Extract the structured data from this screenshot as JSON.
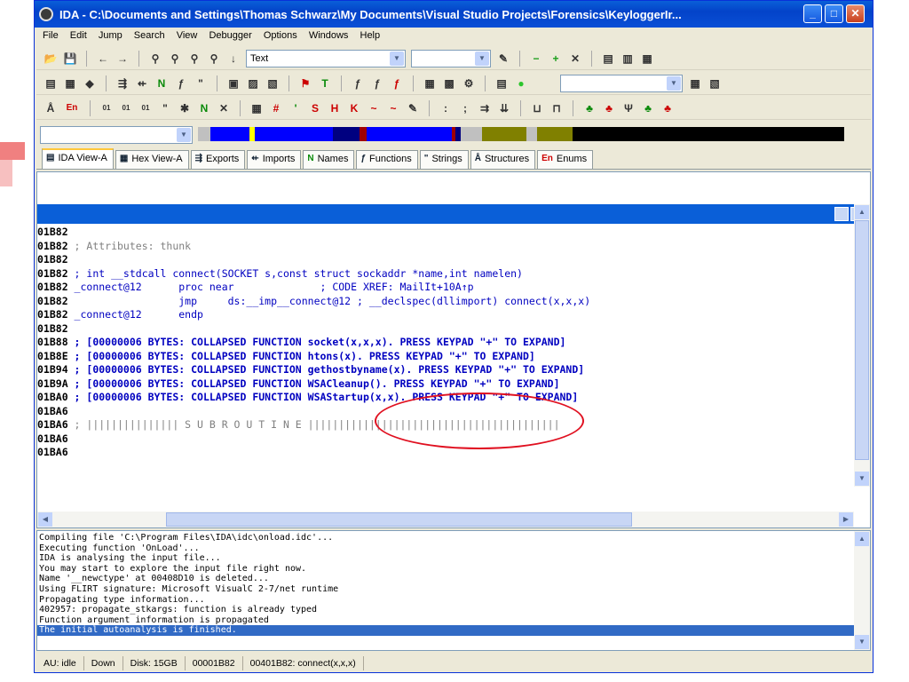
{
  "window": {
    "title": "IDA - C:\\Documents and Settings\\Thomas Schwarz\\My Documents\\Visual Studio Projects\\Forensics\\KeyloggerIr..."
  },
  "menu": [
    "File",
    "Edit",
    "Jump",
    "Search",
    "View",
    "Debugger",
    "Options",
    "Windows",
    "Help"
  ],
  "toolbar": {
    "text_combo_value": "Text"
  },
  "tabs": [
    {
      "label": "IDA View-A",
      "icon": "view-icon"
    },
    {
      "label": "Hex View-A",
      "icon": "hex-icon"
    },
    {
      "label": "Exports",
      "icon": "exports-icon"
    },
    {
      "label": "Imports",
      "icon": "imports-icon"
    },
    {
      "label": "Names",
      "icon": "names-icon"
    },
    {
      "label": "Functions",
      "icon": "functions-icon"
    },
    {
      "label": "Strings",
      "icon": "strings-icon"
    },
    {
      "label": "Structures",
      "icon": "structures-icon"
    },
    {
      "label": "Enums",
      "icon": "enums-icon"
    }
  ],
  "disasm": {
    "lines": [
      {
        "addr": "01B82",
        "text": ""
      },
      {
        "addr": "01B82",
        "text": " ; Attributes: thunk"
      },
      {
        "addr": "01B82",
        "text": ""
      },
      {
        "addr": "01B82",
        "text": " ; int __stdcall connect(SOCKET s,const struct sockaddr *name,int namelen)"
      },
      {
        "addr": "01B82",
        "text": " _connect@12      proc near              ; CODE XREF: MailIt+10A↑p"
      },
      {
        "addr": "01B82",
        "text": "                  jmp     ds:__imp__connect@12 ; __declspec(dllimport) connect(x,x,x)"
      },
      {
        "addr": "01B82",
        "text": " _connect@12      endp"
      },
      {
        "addr": "01B82",
        "text": ""
      },
      {
        "addr": "01B88",
        "text": " ; [00000006 BYTES: COLLAPSED FUNCTION socket(x,x,x). PRESS KEYPAD \"+\" TO EXPAND]"
      },
      {
        "addr": "01B8E",
        "text": " ; [00000006 BYTES: COLLAPSED FUNCTION htons(x). PRESS KEYPAD \"+\" TO EXPAND]"
      },
      {
        "addr": "01B94",
        "text": " ; [00000006 BYTES: COLLAPSED FUNCTION gethostbyname(x). PRESS KEYPAD \"+\" TO EXPAND]"
      },
      {
        "addr": "01B9A",
        "text": " ; [00000006 BYTES: COLLAPSED FUNCTION WSACleanup(). PRESS KEYPAD \"+\" TO EXPAND]"
      },
      {
        "addr": "01BA0",
        "text": " ; [00000006 BYTES: COLLAPSED FUNCTION WSAStartup(x,x). PRESS KEYPAD \"+\" TO EXPAND]"
      },
      {
        "addr": "01BA6",
        "text": ""
      },
      {
        "addr": "01BA6",
        "text": " ; ||||||||||||||| S U B R O U T I N E |||||||||||||||||||||||||||||||||||||||||"
      },
      {
        "addr": "01BA6",
        "text": ""
      },
      {
        "addr": "01BA6",
        "text": ""
      }
    ]
  },
  "output": {
    "lines": [
      "Compiling file 'C:\\Program Files\\IDA\\idc\\onload.idc'...",
      "Executing function 'OnLoad'...",
      "IDA is analysing the input file...",
      "You may start to explore the input file right now.",
      "Name '__newctype' at 00408D10 is deleted...",
      "Using FLIRT signature: Microsoft VisualC 2-7/net runtime",
      "Propagating type information...",
      "402957: propagate_stkargs: function is already typed",
      "Function argument information is propagated",
      "The initial autoanalysis is finished."
    ],
    "selected_index": 9
  },
  "status": [
    "AU: idle",
    "Down",
    "Disk: 15GB",
    "00001B82",
    "00401B82: connect(x,x,x)"
  ],
  "colors": {
    "accent_blue": "#0a5fd8",
    "highlight_ring": "#e01020",
    "code_blue": "#0000c0"
  }
}
